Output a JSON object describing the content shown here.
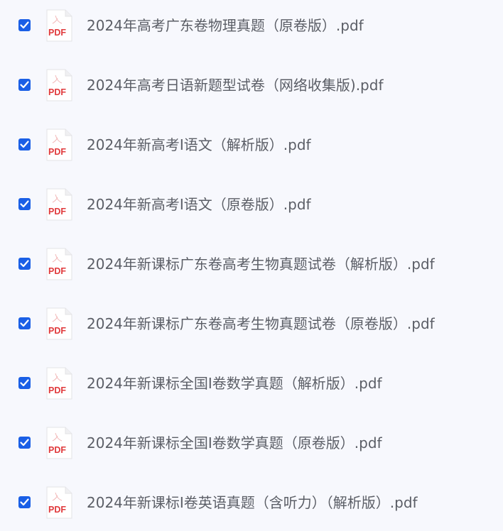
{
  "icons": {
    "checkbox": "checked-checkbox-icon",
    "file": "pdf-file-icon"
  },
  "colors": {
    "background": "#f7f8fd",
    "checkbox": "#1a5fe6",
    "pdf_red": "#e0393b",
    "text": "#5b5e66"
  },
  "files": [
    {
      "name": "2024年高考广东卷物理真题（原卷版）.pdf",
      "checked": true,
      "badge": "PDF"
    },
    {
      "name": "2024年高考日语新题型试卷（网络收集版).pdf",
      "checked": true,
      "badge": "PDF"
    },
    {
      "name": "2024年新高考Ⅰ语文（解析版）.pdf",
      "checked": true,
      "badge": "PDF"
    },
    {
      "name": "2024年新高考Ⅰ语文（原卷版）.pdf",
      "checked": true,
      "badge": "PDF"
    },
    {
      "name": "2024年新课标广东卷高考生物真题试卷（解析版）.pdf",
      "checked": true,
      "badge": "PDF"
    },
    {
      "name": "2024年新课标广东卷高考生物真题试卷（原卷版）.pdf",
      "checked": true,
      "badge": "PDF"
    },
    {
      "name": "2024年新课标全国Ⅰ卷数学真题（解析版）.pdf",
      "checked": true,
      "badge": "PDF"
    },
    {
      "name": "2024年新课标全国Ⅰ卷数学真题（原卷版）.pdf",
      "checked": true,
      "badge": "PDF"
    },
    {
      "name": "2024年新课标Ⅰ卷英语真题（含听力）（解析版）.pdf",
      "checked": true,
      "badge": "PDF"
    }
  ]
}
